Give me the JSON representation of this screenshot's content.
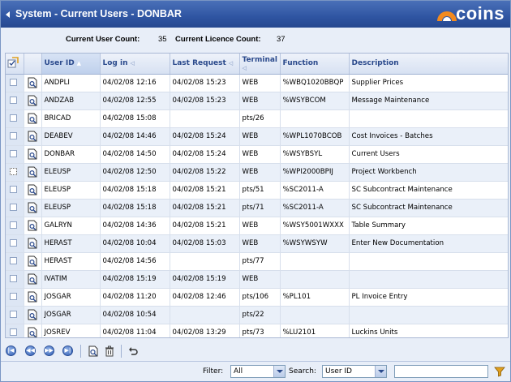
{
  "window": {
    "title": "System - Current Users - DONBAR",
    "logo_text": "coins"
  },
  "counts": {
    "user_label": "Current User Count:",
    "user_value": "35",
    "licence_label": "Current Licence Count:",
    "licence_value": "37"
  },
  "columns": [
    "User ID",
    "Log in",
    "Last Request",
    "Terminal",
    "Function",
    "Description"
  ],
  "sort_arrows": {
    "user_id": "▲",
    "log_in": "◁",
    "last_request": "◁",
    "terminal": "◁"
  },
  "rows": [
    {
      "user": "ANDPLI",
      "login": "04/02/08 12:16",
      "last": "04/02/08 15:23",
      "terminal": "WEB",
      "function": "%WBQ1020BBQP",
      "description": "Supplier Prices"
    },
    {
      "user": "ANDZAB",
      "login": "04/02/08 12:55",
      "last": "04/02/08 15:23",
      "terminal": "WEB",
      "function": "%WSYBCOM",
      "description": "Message Maintenance"
    },
    {
      "user": "BRICAD",
      "login": "04/02/08 15:08",
      "last": "",
      "terminal": "pts/26",
      "function": "",
      "description": ""
    },
    {
      "user": "DEABEV",
      "login": "04/02/08 14:46",
      "last": "04/02/08 15:24",
      "terminal": "WEB",
      "function": "%WPL1070BCOB",
      "description": "Cost Invoices - Batches"
    },
    {
      "user": "DONBAR",
      "login": "04/02/08 14:50",
      "last": "04/02/08 15:24",
      "terminal": "WEB",
      "function": "%WSYBSYL",
      "description": "Current Users"
    },
    {
      "user": "ELEUSP",
      "login": "04/02/08 12:50",
      "last": "04/02/08 15:22",
      "terminal": "WEB",
      "function": "%WPI2000BPIJ",
      "description": "Project Workbench"
    },
    {
      "user": "ELEUSP",
      "login": "04/02/08 15:18",
      "last": "04/02/08 15:21",
      "terminal": "pts/51",
      "function": "%SC2011-A",
      "description": "SC Subcontract Maintenance"
    },
    {
      "user": "ELEUSP",
      "login": "04/02/08 15:18",
      "last": "04/02/08 15:21",
      "terminal": "pts/71",
      "function": "%SC2011-A",
      "description": "SC Subcontract Maintenance"
    },
    {
      "user": "GALRYN",
      "login": "04/02/08 14:36",
      "last": "04/02/08 15:21",
      "terminal": "WEB",
      "function": "%WSY5001WXXX",
      "description": "Table Summary"
    },
    {
      "user": "HERAST",
      "login": "04/02/08 10:04",
      "last": "04/02/08 15:03",
      "terminal": "WEB",
      "function": "%WSYWSYW",
      "description": "Enter New Documentation"
    },
    {
      "user": "HERAST",
      "login": "04/02/08 14:56",
      "last": "",
      "terminal": "pts/77",
      "function": "",
      "description": ""
    },
    {
      "user": "IVATIM",
      "login": "04/02/08 15:19",
      "last": "04/02/08 15:19",
      "terminal": "WEB",
      "function": "",
      "description": ""
    },
    {
      "user": "JOSGAR",
      "login": "04/02/08 11:20",
      "last": "04/02/08 12:46",
      "terminal": "pts/106",
      "function": "%PL101",
      "description": "PL Invoice Entry"
    },
    {
      "user": "JOSGAR",
      "login": "04/02/08 10:54",
      "last": "",
      "terminal": "pts/22",
      "function": "",
      "description": ""
    },
    {
      "user": "JOSREV",
      "login": "04/02/08 11:04",
      "last": "04/02/08 13:29",
      "terminal": "pts/73",
      "function": "%LU2101",
      "description": "Luckins Units"
    }
  ],
  "filterbar": {
    "filter_label": "Filter:",
    "filter_value": "All",
    "search_label": "Search:",
    "search_field": "User ID",
    "search_text": ""
  },
  "colors": {
    "title_bg": "#2f55a2",
    "header_text": "#2b4a8c",
    "alt_row": "#eaf0f9",
    "logo_orange": "#f28a1e"
  }
}
